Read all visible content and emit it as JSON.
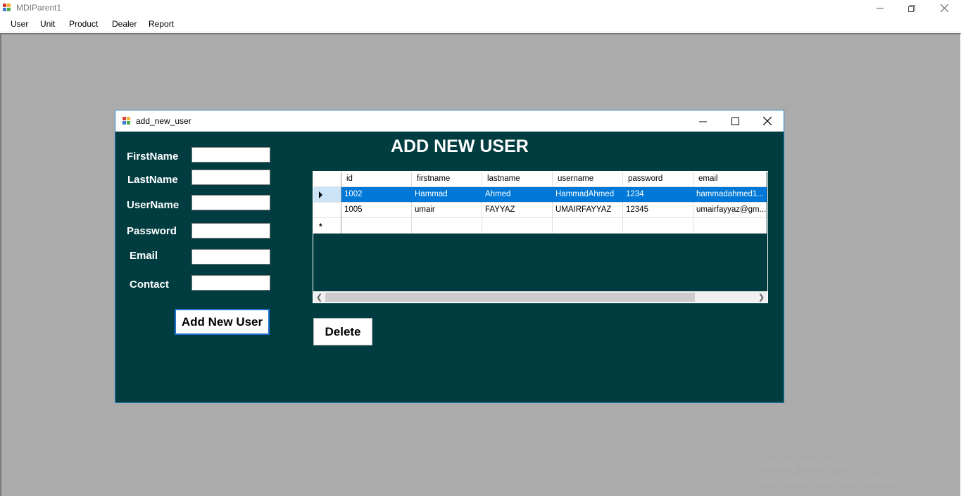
{
  "window": {
    "title": "MDIParent1"
  },
  "menu": [
    "User",
    "Unit",
    "Product",
    "Dealer",
    "Report"
  ],
  "child_form": {
    "title": "add_new_user",
    "heading": "ADD NEW USER",
    "fields": {
      "firstname_label": "FirstName",
      "lastname_label": "LastName",
      "username_label": "UserName",
      "password_label": "Password",
      "email_label": "Email",
      "contact_label": "Contact"
    },
    "add_button": "Add New User",
    "delete_button": "Delete"
  },
  "grid": {
    "columns": [
      "id",
      "firstname",
      "lastname",
      "username",
      "password",
      "email"
    ],
    "rows": [
      [
        "1002",
        "Hammad",
        "Ahmed",
        "HammadAhmed",
        "1234",
        "hammadahmed1..."
      ],
      [
        "1005",
        "umair",
        "FAYYAZ",
        "UMAIRFAYYAZ",
        "12345",
        "umairfayyaz@gm..."
      ]
    ],
    "new_row_marker": "*",
    "selected_row_index": 0
  },
  "watermark": {
    "line1": "Activate Windows",
    "line2": "Go to Settings to activate Windows."
  },
  "colors": {
    "form_background": "#013d40",
    "selection": "#0078d7",
    "mdi_background": "#ababab"
  }
}
